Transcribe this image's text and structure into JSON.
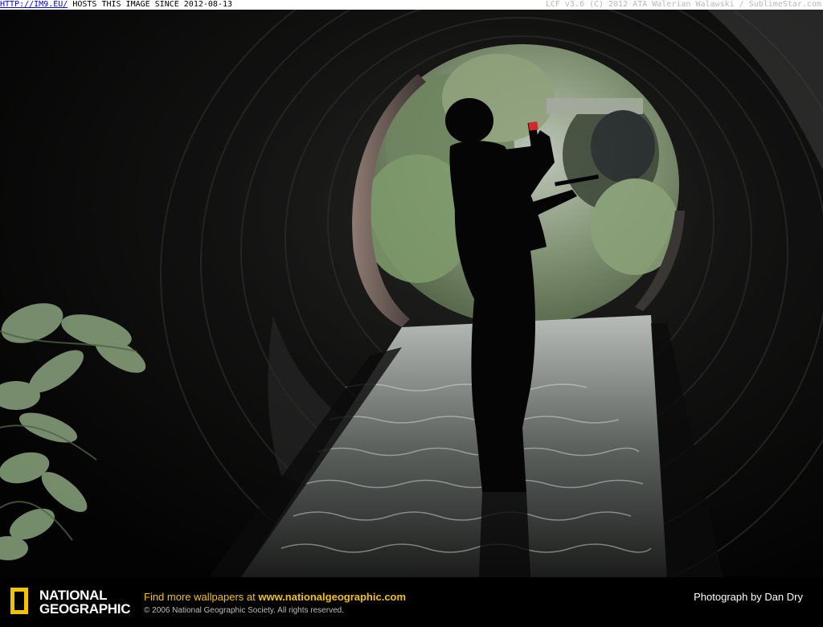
{
  "topbar": {
    "link_text": "HTTP://IM9.EU/",
    "host_text": " HOSTS THIS IMAGE SINCE 2012-08-13",
    "right_text": "LCF v3.6 (C) 2012 ATA Walerian Walawski / SublimeStar.com"
  },
  "footer": {
    "logo_line1": "NATIONAL",
    "logo_line2": "GEOGRAPHIC",
    "promo_prefix": "Find more wallpapers at ",
    "promo_url": "www.nationalgeographic.com",
    "copyright": "© 2006 National Geographic Society. All rights reserved.",
    "credit": "Photograph by Dan Dry"
  },
  "colors": {
    "brand_yellow": "#f2c300",
    "link_blue": "#0000ee"
  }
}
